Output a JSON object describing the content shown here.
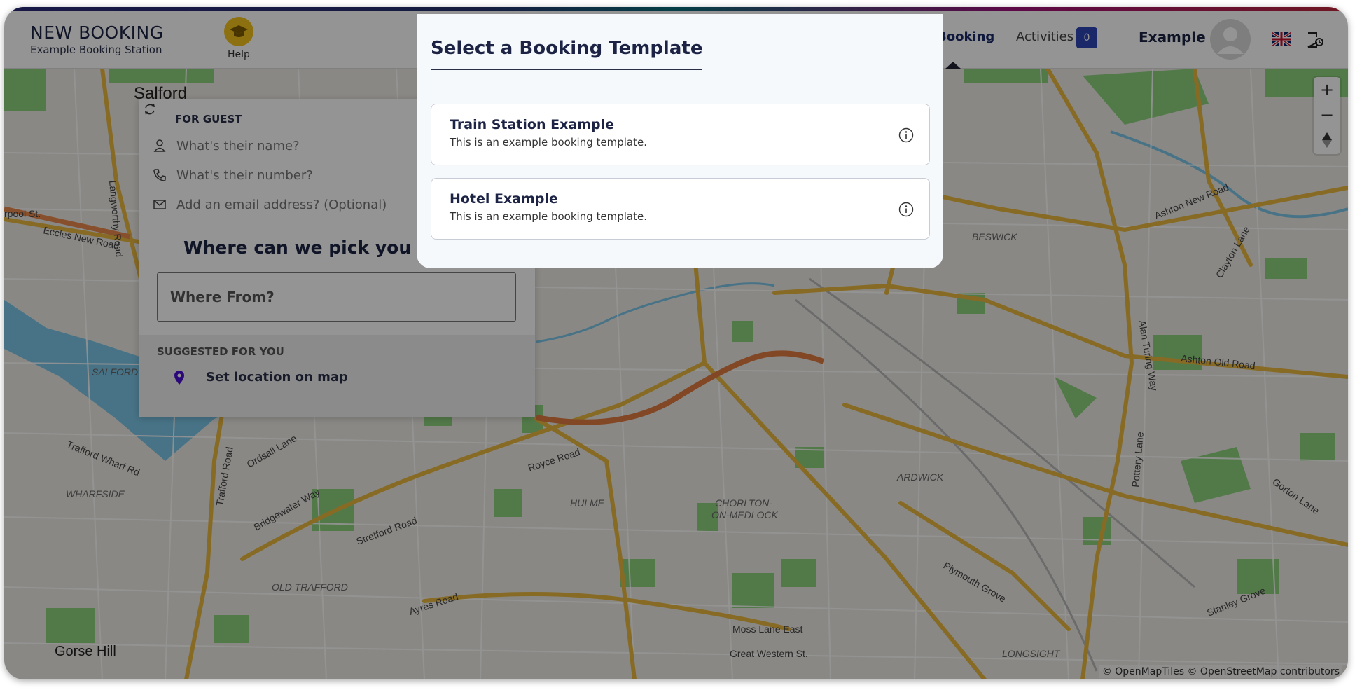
{
  "header": {
    "title": "NEW BOOKING",
    "subtitle": "Example Booking Station",
    "help_label": "Help",
    "nav_booking": "Booking",
    "nav_activities": "Activities",
    "activities_count": "0",
    "user_name": "Example"
  },
  "panel": {
    "guest_title": "FOR GUEST",
    "name_placeholder": "What's their name?",
    "number_placeholder": "What's their number?",
    "email_placeholder": "Add an email address? (Optional)",
    "pickup_heading": "Where can we pick you up",
    "where_placeholder": "Where From?",
    "suggested_title": "SUGGESTED FOR YOU",
    "set_location": "Set location on map"
  },
  "map": {
    "labels": [
      "Salford",
      "SALFORD",
      "Gorse Hill",
      "WHARFSIDE",
      "OLD TRAFFORD",
      "HULME",
      "CHORLTON-",
      "ON-MEDLOCK",
      "ARDWICK",
      "BESWICK",
      "LONGSIGHT",
      "Eccles New Road",
      "Trafford Road",
      "Trafford Wharf Rd",
      "Ordsall Lane",
      "Bridgewater Way",
      "Stretford Road",
      "Royce Road",
      "Ayres Road",
      "Moss Lane East",
      "Great Western St.",
      "Plymouth Grove",
      "Stanley Grove",
      "Gorton Lane",
      "Ashton Old Road",
      "Ashton New Road",
      "Alan Turing Way",
      "Pottery Lane",
      "Clayton Lane",
      "Langworthy Road",
      "rpool St."
    ],
    "attribution": "© OpenMapTiles © OpenStreetMap contributors",
    "zoom_in": "+",
    "zoom_out": "−"
  },
  "modal": {
    "title": "Select a Booking Template",
    "templates": [
      {
        "name": "Train Station Example",
        "description": "This is an example booking template."
      },
      {
        "name": "Hotel Example",
        "description": "This is an example booking template."
      }
    ]
  },
  "colors": {
    "accent": "#2e44b4",
    "help_yellow": "#f3c21b",
    "navy_text": "#1c2344",
    "road_yellow": "#e8b840",
    "water": "#7cc7e8",
    "park": "#8ed27e"
  }
}
